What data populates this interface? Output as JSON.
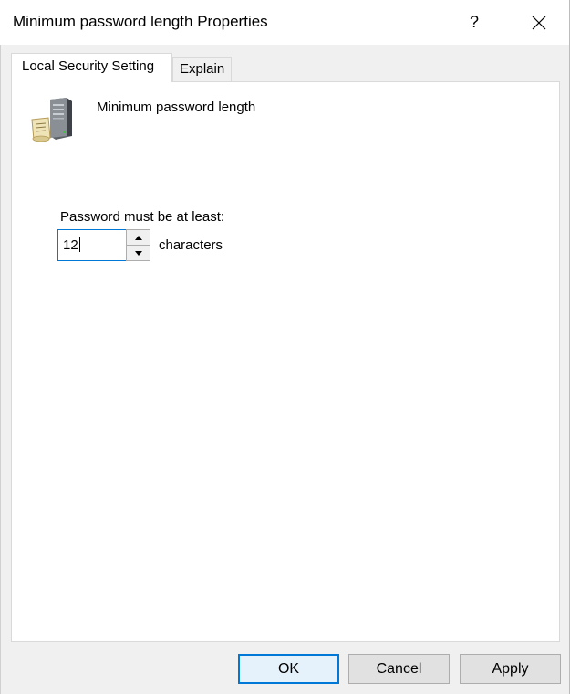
{
  "window": {
    "title": "Minimum password length Properties",
    "help_glyph": "?",
    "close_icon": "close-icon"
  },
  "tabs": [
    {
      "label": "Local Security Setting",
      "active": true
    },
    {
      "label": "Explain",
      "active": false
    }
  ],
  "setting": {
    "icon": "server-policy-icon",
    "policy_name": "Minimum password length",
    "field_label": "Password must be at least:",
    "value": "12",
    "units": "characters"
  },
  "buttons": {
    "ok": "OK",
    "cancel": "Cancel",
    "apply": "Apply"
  },
  "colors": {
    "accent": "#0078d7",
    "window_bg": "#f0f0f0",
    "panel_bg": "#ffffff"
  }
}
